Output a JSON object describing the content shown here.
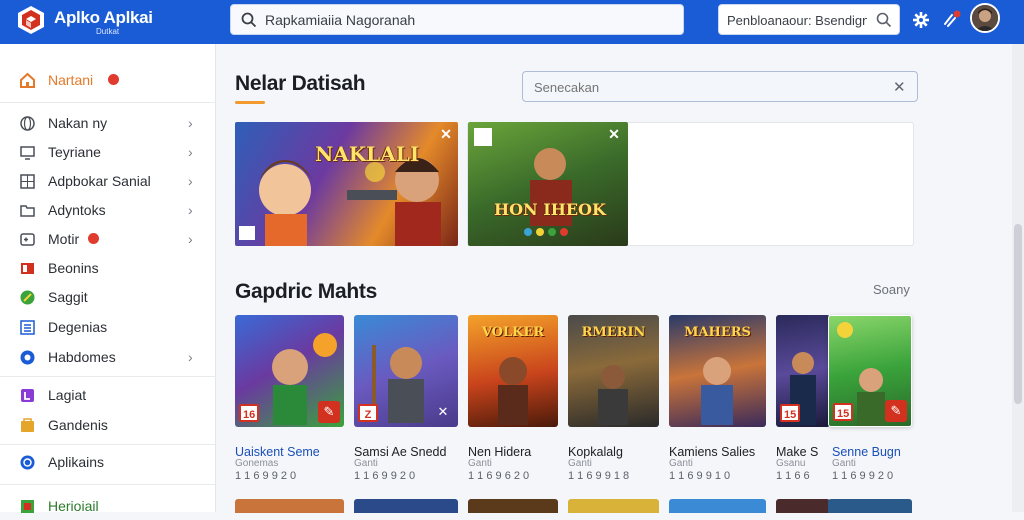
{
  "app": {
    "brand": "Aplko Aplkai",
    "brand_sub": "Dutkat"
  },
  "search": {
    "value": "Rapkamiaiia Nagoranah"
  },
  "search_secondary": {
    "value": "Penbloanaour: Bsendign"
  },
  "sidebar": {
    "items": [
      {
        "label": "Nartani",
        "icon": "home-icon",
        "color": "#e4792a"
      },
      {
        "label": "Nakan ny",
        "icon": "globe-icon",
        "color": "#4a4f57"
      },
      {
        "label": "Teyriane",
        "icon": "monitor-icon",
        "color": "#4a4f57"
      },
      {
        "label": "Adpbokar Sanial",
        "icon": "grid-icon",
        "color": "#4a4f57"
      },
      {
        "label": "Adyntoks",
        "icon": "folder-icon",
        "color": "#4a4f57"
      },
      {
        "label": "Motir",
        "icon": "controller-icon",
        "color": "#4a4f57"
      },
      {
        "label": "Beonins",
        "icon": "book-icon",
        "color": "#d2311f"
      },
      {
        "label": "Saggit",
        "icon": "leaf-icon",
        "color": "#3aa33b"
      },
      {
        "label": "Degenias",
        "icon": "list-icon",
        "color": "#1a5bd6"
      },
      {
        "label": "Habdomes",
        "icon": "compass-icon",
        "color": "#1a5bd6"
      },
      {
        "label": "Lagiat",
        "icon": "tag-icon",
        "color": "#8a3bd6"
      },
      {
        "label": "Gandenis",
        "icon": "bag-icon",
        "color": "#e4a52a"
      },
      {
        "label": "Aplikains",
        "icon": "apps-icon",
        "color": "#1a5bd6"
      },
      {
        "label": "Herioiail",
        "icon": "badge-icon",
        "color": "#3aa33b"
      }
    ]
  },
  "featured": {
    "title": "Nelar Datisah",
    "filter_placeholder": "Senecakan",
    "banners": [
      {
        "title": "NAKLALI"
      },
      {
        "title": "HON IHEOK"
      }
    ]
  },
  "games": {
    "title": "Gapdric Mahts",
    "more": "Soany",
    "cards": [
      {
        "name": "Uaiskent Seme",
        "meta": "Gonemas",
        "size": "1 1 6 9 9  2 0",
        "age": "16",
        "name_color": "#1a4fb8"
      },
      {
        "name": "Samsi Ae Snedd",
        "meta": "Ganti",
        "size": "1 1 6 9 9  2 0",
        "age": "Z",
        "name_color": "#202124"
      },
      {
        "name": "Nen Hidera",
        "meta": "Ganti",
        "size": "1 1 6 9 6  2 0",
        "age": "",
        "name_color": "#202124"
      },
      {
        "name": "Kopkalalg",
        "meta": "Ganti",
        "size": "1 1 6 9 9  1 8",
        "age": "",
        "name_color": "#202124"
      },
      {
        "name": "Kamiens Salies",
        "meta": "Ganti",
        "size": "1 1 6 9 9  1 0",
        "age": "",
        "name_color": "#202124"
      },
      {
        "name": "Make S",
        "meta": "Gsanu",
        "size": "1 1 6 6",
        "age": "15",
        "name_color": "#202124"
      },
      {
        "name": "Senne Bugn",
        "meta": "Ganti",
        "size": "1 1 6 9 9  2 0",
        "age": "15",
        "name_color": "#1a4fb8"
      }
    ]
  },
  "colors": {
    "accent": "#1a5bd6",
    "underline": "#f29a2e",
    "badge": "#e03b2f"
  }
}
